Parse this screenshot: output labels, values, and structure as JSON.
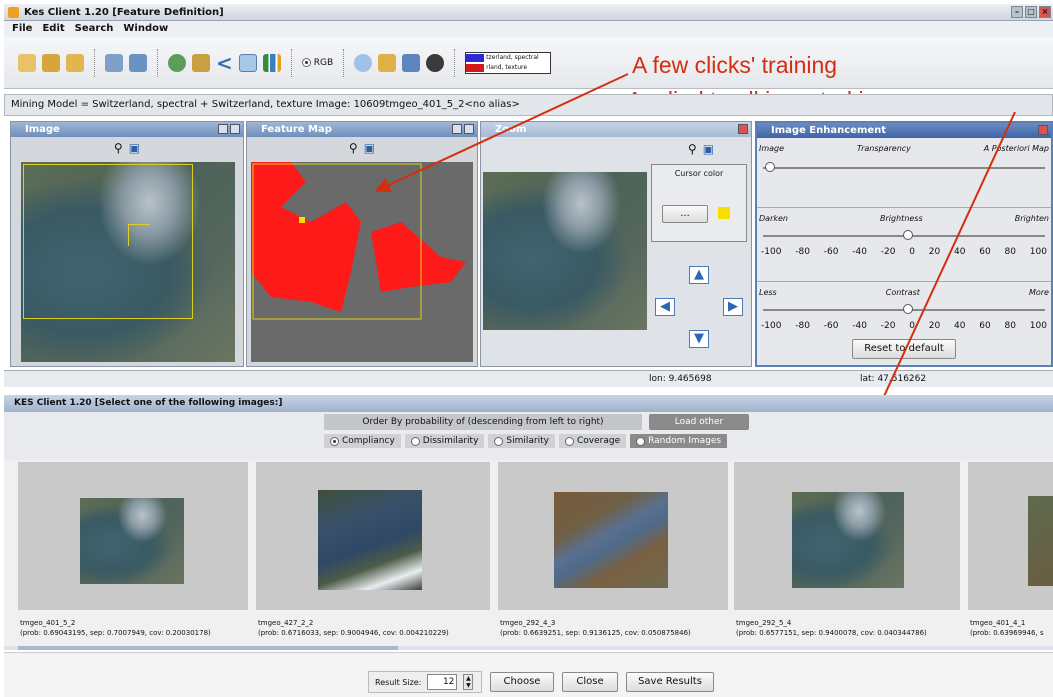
{
  "window": {
    "title": "Kes Client 1.20 [Feature Definition]"
  },
  "menu": [
    "File",
    "Edit",
    "Search",
    "Window"
  ],
  "toolbar": {
    "rgb_label": "RGB",
    "legend": [
      {
        "label": "tzerland, spectral",
        "color": "#2a2ad6"
      },
      {
        "label": "rland, texture",
        "color": "#d31818"
      }
    ]
  },
  "annotations": {
    "line1": "A few clicks' training",
    "line2": "Applied to all ingested images"
  },
  "infobar": {
    "text": "Mining Model = Switzerland, spectral + Switzerland, texture    Image: 10609tmgeo_401_5_2<no alias>"
  },
  "panels": {
    "image": {
      "title": "Image"
    },
    "feature_map": {
      "title": "Feature Map"
    },
    "zoom": {
      "title": "Zoom",
      "cursor_color_label": "Cursor color",
      "cursor_btn": "..."
    },
    "enhancement": {
      "title": "Image Enhancement",
      "transparency": {
        "left": "Image",
        "center": "Transparency",
        "right": "A Posteriori Map"
      },
      "brightness": {
        "left": "Darken",
        "center": "Brightness",
        "right": "Brighten"
      },
      "contrast": {
        "left": "Less",
        "center": "Contrast",
        "right": "More"
      },
      "ticks": [
        "-100",
        "-80",
        "-60",
        "-40",
        "-20",
        "0",
        "20",
        "40",
        "60",
        "80",
        "100"
      ],
      "reset": "Reset to default"
    }
  },
  "status": {
    "lon": "lon: 9.465698",
    "lat": "lat: 47.516262"
  },
  "select_window": {
    "title": "KES Client 1.20 [Select one of the following images:]"
  },
  "order": {
    "label": "Order By probability of (descending from left to right)",
    "load_other": "Load other",
    "options": [
      "Compliancy",
      "Dissimilarity",
      "Similarity",
      "Coverage",
      "Random Images"
    ],
    "selected": "Compliancy"
  },
  "results": [
    {
      "name": "tmgeo_401_5_2",
      "stats": "(prob: 0.69043195, sep: 0.7007949, cov: 0.20030178)"
    },
    {
      "name": "tmgeo_427_2_2",
      "stats": "(prob: 0.6716033, sep: 0.9004946, cov: 0.004210229)"
    },
    {
      "name": "tmgeo_292_4_3",
      "stats": "(prob: 0.6639251, sep: 0.9136125, cov: 0.050875846)"
    },
    {
      "name": "tmgeo_292_5_4",
      "stats": "(prob: 0.6577151, sep: 0.9400078, cov: 0.040344786)"
    },
    {
      "name": "tmgeo_401_4_1",
      "stats": "(prob: 0.63969946, s"
    }
  ],
  "bottom": {
    "result_size_label": "Result Size:",
    "result_size": "12",
    "choose": "Choose",
    "close": "Close",
    "save": "Save Results"
  },
  "colors": {
    "annotation": "#d32f0f",
    "feature_red": "#ff1a1a",
    "title_blue": "#7a97c4"
  }
}
